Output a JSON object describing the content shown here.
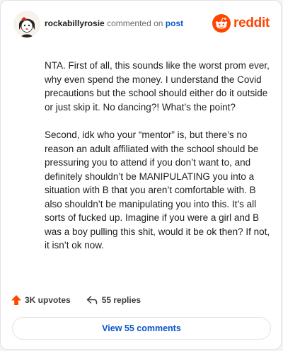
{
  "comment": {
    "username": "rockabillyrosie",
    "action_text": "commented on",
    "post_link": "post",
    "paragraphs": [
      "NTA. First of all, this sounds like the worst prom ever, why even spend the money. I understand the Covid precautions but the school should either do it outside or just skip it. No dancing?! What’s the point?",
      "Second, idk who your “mentor” is, but there’s no reason an adult affiliated with the school should be pressuring you to attend if you don’t want to, and definitely shouldn’t be MANIPULATING you into a situation with B that you aren’t comfortable with. B also shouldn’t be manipulating you into this. It’s all sorts of fucked up. Imagine if you were a girl and B was a boy pulling this shit, would it be ok then? If not, it isn’t ok now."
    ]
  },
  "brand": {
    "name": "reddit",
    "color": "#ff4500"
  },
  "actions": {
    "upvotes": "3K upvotes",
    "replies": "55 replies"
  },
  "footer": {
    "view_comments": "View 55 comments"
  },
  "colors": {
    "accent_orange": "#ff4500",
    "link_blue": "#0a56c9"
  },
  "icons": {
    "avatar": "snoo-avatar",
    "brand": "reddit-snoo-icon",
    "upvote": "upvote-arrow-icon",
    "reply": "reply-arrow-icon"
  }
}
